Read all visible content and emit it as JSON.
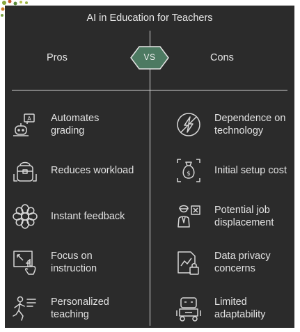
{
  "title": "AI in Education for Teachers",
  "vs_label": "VS",
  "columns": {
    "pros": "Pros",
    "cons": "Cons"
  },
  "pros": [
    {
      "label": "Automates grading",
      "icon": "robot-grading-icon"
    },
    {
      "label": "Reduces workload",
      "icon": "backpack-icon"
    },
    {
      "label": "Instant feedback",
      "icon": "flower-icon"
    },
    {
      "label": "Focus on instruction",
      "icon": "pointer-focus-icon"
    },
    {
      "label": "Personalized teaching",
      "icon": "teacher-icon"
    }
  ],
  "cons": [
    {
      "label": "Dependence on technology",
      "icon": "power-off-icon"
    },
    {
      "label": "Initial setup cost",
      "icon": "money-bag-icon"
    },
    {
      "label": "Potential job displacement",
      "icon": "worker-cross-icon"
    },
    {
      "label": "Data privacy concerns",
      "icon": "locked-chart-icon"
    },
    {
      "label": "Limited adaptability",
      "icon": "robot-icon"
    }
  ],
  "colors": {
    "panel": "#2b2b2b",
    "vs_badge": "#4d7a62",
    "line": "#d8d8d8",
    "text": "#e2e2e2"
  }
}
